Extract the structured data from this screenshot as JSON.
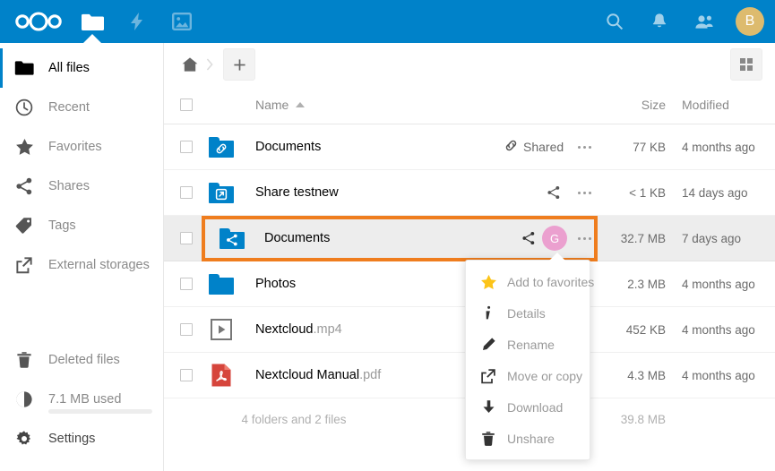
{
  "colors": {
    "brand": "#0082c9",
    "highlight": "#ef7d1e",
    "avatar_top": "#ddbb6e",
    "avatar_share": "#eba0cf",
    "pdf_red": "#d6453c",
    "star_yellow": "#fcc419"
  },
  "header": {
    "logo_name": "nextcloud-logo",
    "apps": [
      {
        "name": "files",
        "icon": "folder-icon",
        "active": true
      },
      {
        "name": "activity",
        "icon": "lightning-icon",
        "active": false
      },
      {
        "name": "photos",
        "icon": "picture-icon",
        "active": false
      }
    ],
    "right": [
      {
        "name": "search",
        "icon": "magnifier-icon"
      },
      {
        "name": "notifications",
        "icon": "bell-icon"
      },
      {
        "name": "contacts",
        "icon": "contacts-icon"
      }
    ],
    "avatar_initial": "B"
  },
  "sidebar": {
    "items": [
      {
        "label": "All files",
        "icon": "folder-icon",
        "active": true
      },
      {
        "label": "Recent",
        "icon": "clock-icon",
        "active": false
      },
      {
        "label": "Favorites",
        "icon": "star-icon",
        "active": false
      },
      {
        "label": "Shares",
        "icon": "share-icon",
        "active": false
      },
      {
        "label": "Tags",
        "icon": "tag-icon",
        "active": false
      },
      {
        "label": "External storages",
        "icon": "external-link-icon",
        "active": false
      }
    ],
    "bottom": [
      {
        "label": "Deleted files",
        "icon": "trash-icon"
      },
      {
        "label": "7.1 MB used",
        "icon": "pie-icon"
      },
      {
        "label": "Settings",
        "icon": "gear-icon"
      }
    ]
  },
  "controls": {
    "home_label": "Home",
    "new_label": "+",
    "grid_label": "Grid view"
  },
  "table": {
    "headers": {
      "name": "Name",
      "size": "Size",
      "modified": "Modified"
    },
    "sort": "ascending",
    "rows": [
      {
        "name": "Documents",
        "ext": "",
        "icon": "folder-link-icon",
        "share_label": "Shared",
        "share_icon": "link-icon",
        "avatar": null,
        "size": "77 KB",
        "modified": "4 months ago",
        "selected": false
      },
      {
        "name": "Share testnew",
        "ext": "",
        "icon": "folder-external-icon",
        "share_label": "",
        "share_icon": "share-icon",
        "avatar": null,
        "size": "< 1 KB",
        "modified": "14 days ago",
        "selected": false
      },
      {
        "name": "Documents",
        "ext": "",
        "icon": "folder-share-icon",
        "share_label": "",
        "share_icon": "share-icon",
        "avatar": "G",
        "size": "32.7 MB",
        "modified": "7 days ago",
        "selected": true
      },
      {
        "name": "Photos",
        "ext": "",
        "icon": "folder-icon",
        "share_label": "",
        "share_icon": "",
        "avatar": null,
        "size": "2.3 MB",
        "modified": "4 months ago",
        "selected": false
      },
      {
        "name": "Nextcloud",
        "ext": ".mp4",
        "icon": "video-icon",
        "share_label": "",
        "share_icon": "",
        "avatar": null,
        "size": "452 KB",
        "modified": "4 months ago",
        "selected": false
      },
      {
        "name": "Nextcloud Manual",
        "ext": ".pdf",
        "icon": "pdf-icon",
        "share_label": "",
        "share_icon": "",
        "avatar": null,
        "size": "4.3 MB",
        "modified": "4 months ago",
        "selected": false
      }
    ],
    "summary": {
      "count": "4 folders and 2 files",
      "total_size": "39.8 MB"
    }
  },
  "context_menu": {
    "items": [
      {
        "label": "Add to favorites",
        "icon": "star-icon"
      },
      {
        "label": "Details",
        "icon": "info-icon"
      },
      {
        "label": "Rename",
        "icon": "pencil-icon"
      },
      {
        "label": "Move or copy",
        "icon": "external-link-icon"
      },
      {
        "label": "Download",
        "icon": "download-icon"
      },
      {
        "label": "Unshare",
        "icon": "trash-icon"
      }
    ]
  }
}
